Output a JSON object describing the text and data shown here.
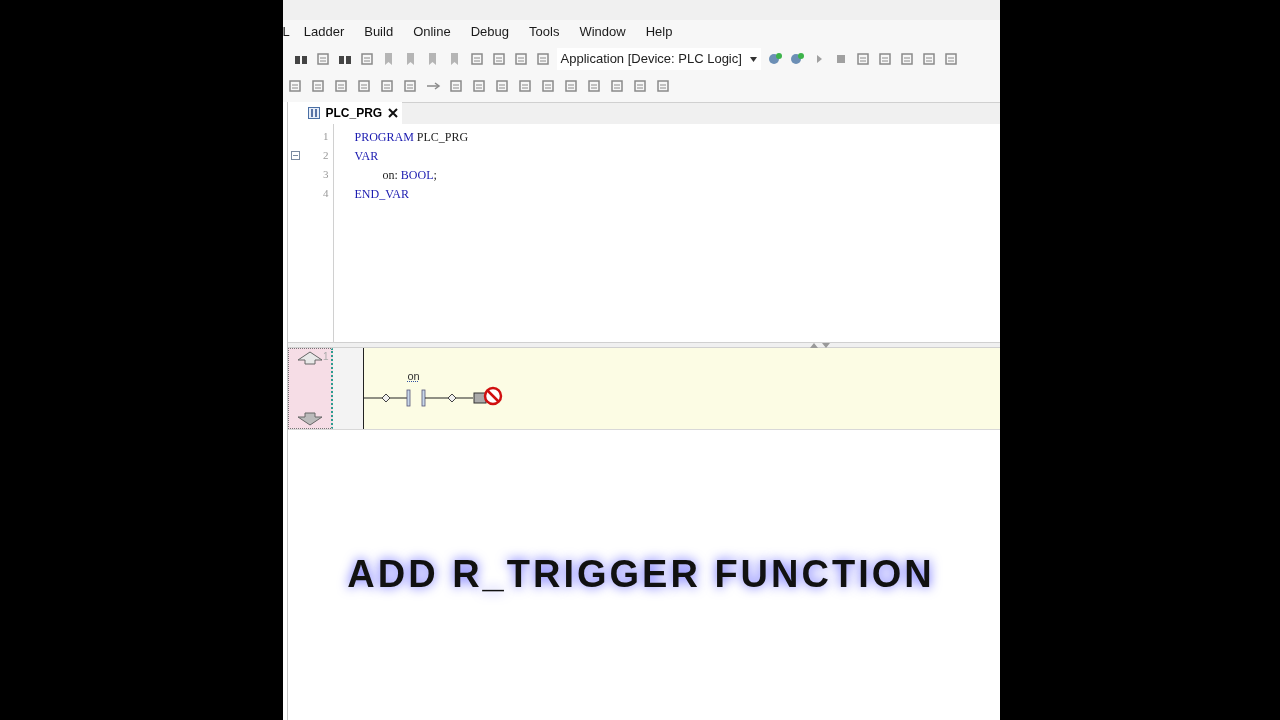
{
  "menu": [
    "L",
    "Ladder",
    "Build",
    "Online",
    "Debug",
    "Tools",
    "Window",
    "Help"
  ],
  "toolbar": {
    "app_selector": "Application [Device: PLC Logic]"
  },
  "tab": {
    "label": "PLC_PRG",
    "selected": true
  },
  "code_lines": [
    {
      "number": "1",
      "fold": false,
      "indent": false,
      "tokens": [
        {
          "kind": "keyword",
          "text": "PROGRAM"
        },
        {
          "kind": "plain",
          "text": " PLC_PRG"
        }
      ]
    },
    {
      "number": "2",
      "fold": true,
      "indent": false,
      "tokens": [
        {
          "kind": "keyword",
          "text": "VAR"
        }
      ]
    },
    {
      "number": "3",
      "fold": false,
      "indent": true,
      "tokens": [
        {
          "kind": "plain",
          "text": "on: "
        },
        {
          "kind": "keyword",
          "text": "BOOL"
        },
        {
          "kind": "plain",
          "text": ";"
        }
      ]
    },
    {
      "number": "4",
      "fold": false,
      "indent": false,
      "tokens": [
        {
          "kind": "keyword",
          "text": "END_VAR"
        }
      ]
    }
  ],
  "ladder": {
    "rung_number": "1",
    "contact_variable": "on"
  },
  "caption": "ADD R_TRIGGER FUNCTION"
}
